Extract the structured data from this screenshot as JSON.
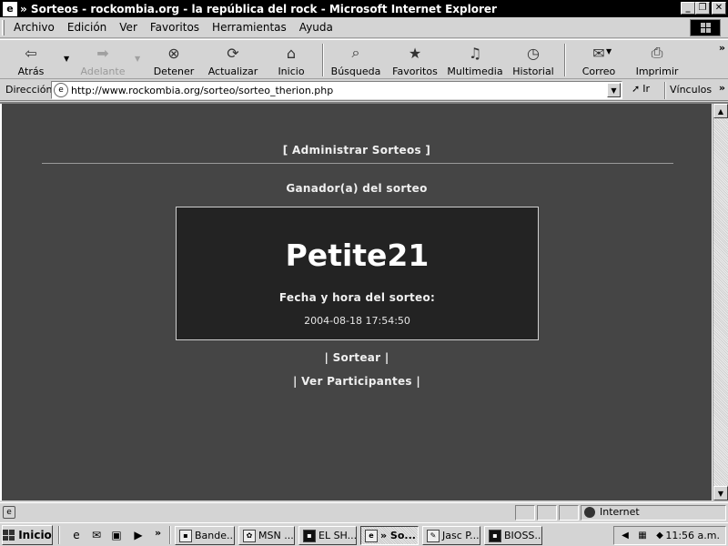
{
  "window": {
    "title": "» Sorteos - rockombia.org - la república del rock - Microsoft Internet Explorer",
    "minimize_glyph": "_",
    "maximize_glyph": "❐",
    "close_glyph": "✕"
  },
  "menu": [
    {
      "label": "Archivo"
    },
    {
      "label": "Edición"
    },
    {
      "label": "Ver"
    },
    {
      "label": "Favoritos"
    },
    {
      "label": "Herramientas"
    },
    {
      "label": "Ayuda"
    }
  ],
  "toolbar": {
    "back": "Atrás",
    "forward": "Adelante",
    "stop": "Detener",
    "refresh": "Actualizar",
    "home": "Inicio",
    "search": "Búsqueda",
    "favorites": "Favoritos",
    "media": "Multimedia",
    "history": "Historial",
    "mail": "Correo",
    "print": "Imprimir",
    "more": "»"
  },
  "address": {
    "label": "Dirección",
    "url": "http://www.rockombia.org/sorteo/sorteo_therion.php",
    "go": "Ir",
    "links": "Vínculos",
    "links_more": "»"
  },
  "page": {
    "admin_link": "[ Administrar Sorteos ]",
    "winner_heading": "Ganador(a) del sorteo",
    "winner_name": "Petite21",
    "draw_label": "Fecha y hora del sorteo:",
    "draw_datetime": "2004-08-18 17:54:50",
    "sortear_link": "| Sortear |",
    "participants_link": "| Ver Participantes |"
  },
  "status": {
    "text": "",
    "zone": "Internet"
  },
  "taskbar": {
    "start": "Inicio",
    "quicklaunch_more": "»",
    "tasks": [
      {
        "label": "Bande..."
      },
      {
        "label": "MSN ..."
      },
      {
        "label": "EL SH..."
      },
      {
        "label": "» So..."
      },
      {
        "label": "Jasc P..."
      },
      {
        "label": "BIOSS..."
      }
    ],
    "clock": "11:56 a.m."
  },
  "icons": {
    "back": "arrow-left-icon",
    "forward": "arrow-right-icon",
    "stop": "stop-icon",
    "refresh": "refresh-icon",
    "home": "home-icon",
    "search": "search-icon",
    "favorites": "favorites-folder-icon",
    "media": "media-icon",
    "history": "history-icon",
    "mail": "mail-icon",
    "print": "printer-icon"
  }
}
